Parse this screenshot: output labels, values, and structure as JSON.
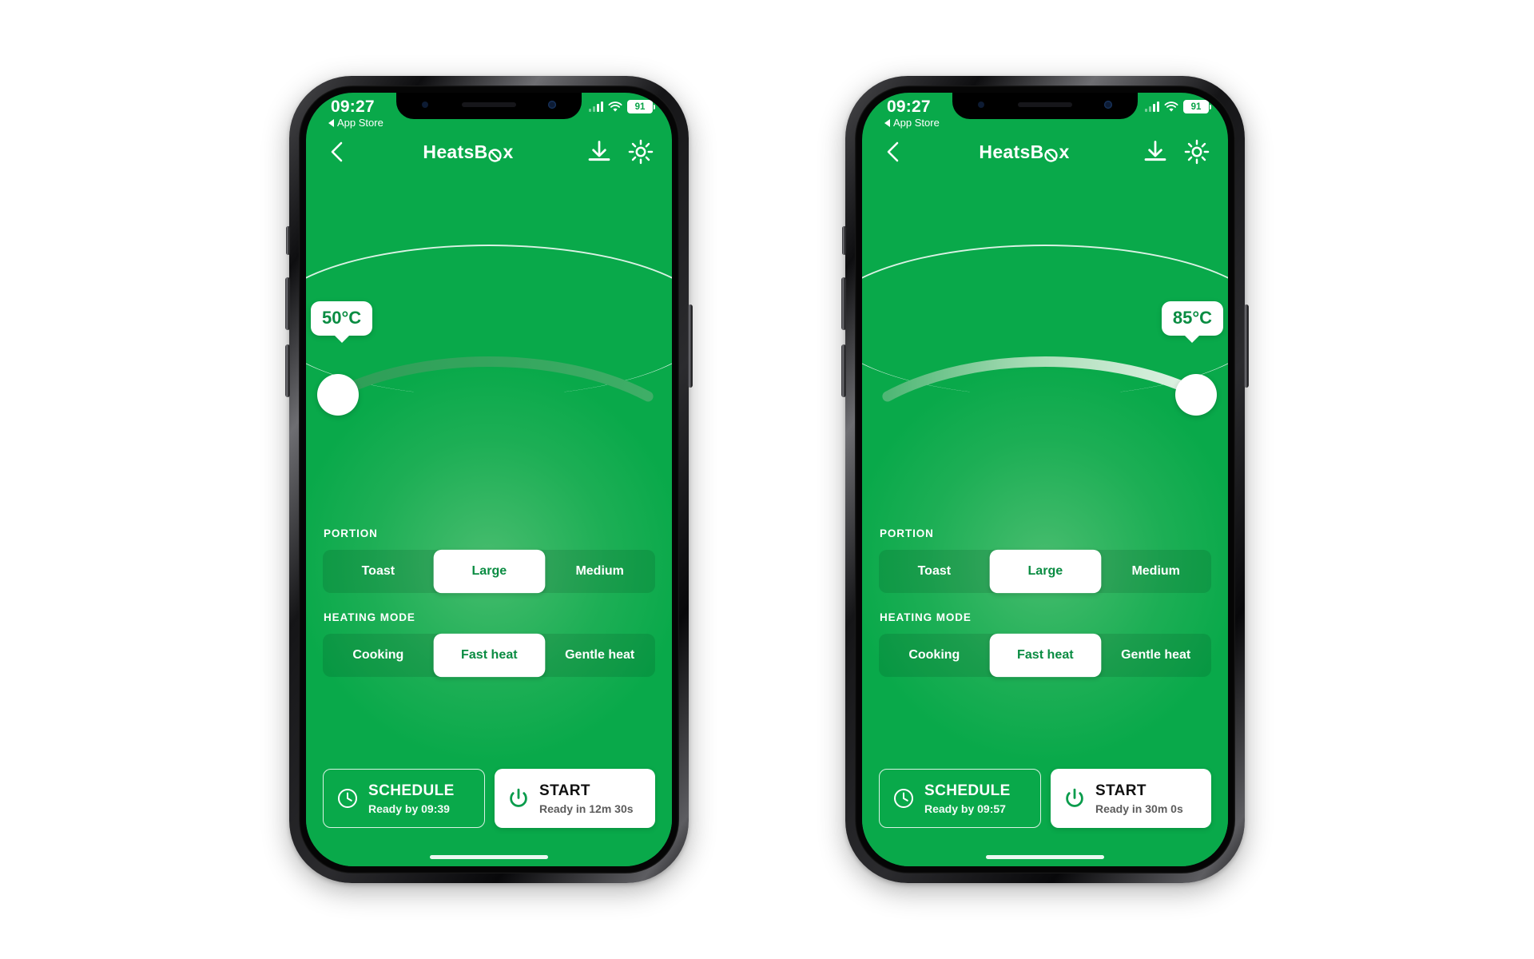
{
  "app": {
    "title": "HeatsBox",
    "brand_green": "#09a94a",
    "accent_green": "#0a8c42"
  },
  "status_bar": {
    "time": "09:27",
    "back_label": "App Store",
    "back_icon": "triangle-left-icon",
    "signal_icon": "cellular-signal-icon",
    "wifi_icon": "wifi-icon",
    "battery_icon": "battery-icon",
    "battery_level": "91"
  },
  "nav": {
    "back_icon": "chevron-left-icon",
    "download_icon": "download-icon",
    "settings_icon": "gear-icon",
    "title_part1": "Heats",
    "title_part2": "B",
    "title_part3": "x"
  },
  "sections": {
    "portion_label": "PORTION",
    "heating_label": "HEATING MODE"
  },
  "portion_options": [
    "Toast",
    "Large",
    "Medium"
  ],
  "heating_options": [
    "Cooking",
    "Fast heat",
    "Gentle heat"
  ],
  "phones": [
    {
      "id": "phone-left",
      "temperature": "50°C",
      "temperature_value": 50,
      "knob_position_pct": 4,
      "portion_selected": "Large",
      "heating_selected": "Fast heat",
      "schedule": {
        "icon": "clock-icon",
        "title": "SCHEDULE",
        "subtitle": "Ready by 09:39"
      },
      "start": {
        "icon": "power-icon",
        "title": "START",
        "subtitle": "Ready in 12m 30s"
      }
    },
    {
      "id": "phone-right",
      "temperature": "85°C",
      "temperature_value": 85,
      "knob_position_pct": 96,
      "portion_selected": "Large",
      "heating_selected": "Fast heat",
      "schedule": {
        "icon": "clock-icon",
        "title": "SCHEDULE",
        "subtitle": "Ready by 09:57"
      },
      "start": {
        "icon": "power-icon",
        "title": "START",
        "subtitle": "Ready in 30m 0s"
      }
    }
  ]
}
